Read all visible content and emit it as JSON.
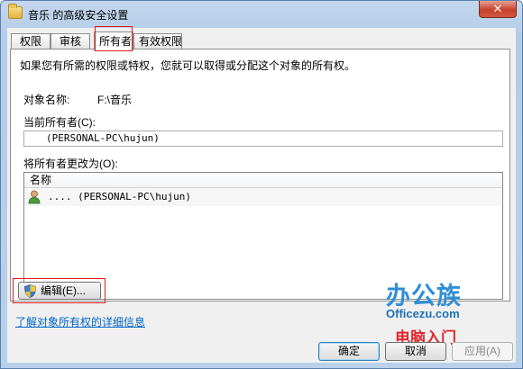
{
  "window": {
    "title": "音乐 的高级安全设置",
    "close_glyph": "✕"
  },
  "tabs": [
    {
      "label": "权限",
      "active": false
    },
    {
      "label": "审核",
      "active": false
    },
    {
      "label": "所有者",
      "active": true
    },
    {
      "label": "有效权限",
      "active": false
    }
  ],
  "owner_tab": {
    "intro": "如果您有所需的权限或特权，您就可以取得或分配这个对象的所有权。",
    "object_name_label": "对象名称:",
    "object_name_value": "F:\\音乐",
    "current_owner_label": "当前所有者(C):",
    "current_owner_value": "(PERSONAL-PC\\hujun)",
    "change_owner_label": "将所有者更改为(O):",
    "list": {
      "column_header": "名称",
      "rows": [
        {
          "name": ".... (PERSONAL-PC\\hujun)",
          "icon": "user-icon"
        }
      ]
    },
    "edit_button": "编辑(E)...",
    "learn_more_link": "了解对象所有权的详细信息"
  },
  "footer": {
    "ok": "确定",
    "cancel": "取消",
    "apply": "应用(A)"
  },
  "watermark": {
    "brand": "办公族",
    "url": "Officezu.com",
    "sub": "电脑入门"
  },
  "colors": {
    "highlight": "#e21c1c",
    "link": "#0066cc",
    "watermark_blue": "#2e8fd6",
    "watermark_red": "#e0262b"
  }
}
